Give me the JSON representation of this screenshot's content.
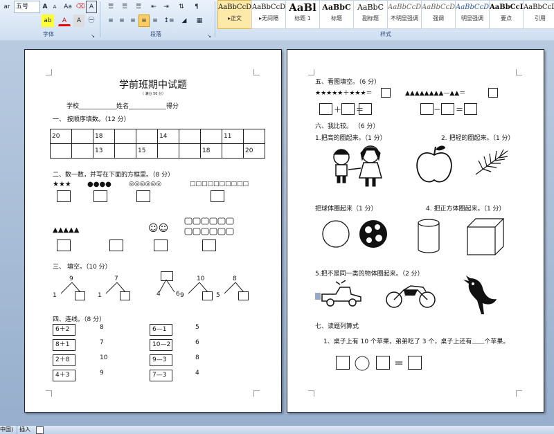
{
  "ribbon": {
    "font_name": "ar",
    "font_size": "五号",
    "font_grow": "A",
    "font_shrink": "A",
    "clear_format": "Aa",
    "phonetic": "wén",
    "char_border": "A",
    "group_font": "字体",
    "group_paragraph": "段落",
    "group_styles": "样式",
    "styles": [
      {
        "preview": "AaBbCcDc",
        "name": "▸正文"
      },
      {
        "preview": "AaBbCcDc",
        "name": "▸无间隔"
      },
      {
        "preview": "AaBl",
        "name": "标题 1"
      },
      {
        "preview": "AaBbC",
        "name": "标题"
      },
      {
        "preview": "AaBbC",
        "name": "副标题"
      },
      {
        "preview": "AaBbCcDc",
        "name": "不明显强调"
      },
      {
        "preview": "AaBbCcDc",
        "name": "强调"
      },
      {
        "preview": "AaBbCcDc",
        "name": "明显强调"
      },
      {
        "preview": "AaBbCcD",
        "name": "要点"
      },
      {
        "preview": "AaBbCcDc",
        "name": "引用"
      }
    ],
    "accent": "#eaf2fb"
  },
  "page1": {
    "title": "学前班期中试题",
    "score_note": "（ 满分 50 分）",
    "info_line": "学校____________姓名____________得分",
    "s1_title": "一、  按顺序填数。（12 分）",
    "s1_rows": [
      [
        "20",
        "",
        "18",
        "",
        "",
        "14",
        "",
        "",
        "11"
      ],
      [
        "",
        "",
        "13",
        "",
        "15",
        "",
        "",
        "18",
        "",
        "20"
      ]
    ],
    "s2_title": "二、数一数，并写在下面的方框里。（8 分）",
    "s2_stars": "★★★",
    "s2_dots": "●●●●",
    "s2_circles": "◎◎◎◎◎◎",
    "s2_squares": "□□□□□□□□□□",
    "s2_triangles": "▲▲▲▲▲",
    "s2_smiles": "☺☺",
    "s3_title": "三、  填空。（10 分）",
    "s3_items": [
      {
        "top": "9",
        "left": "1"
      },
      {
        "top": "7",
        "left": "1"
      },
      {
        "top": "",
        "left": "4",
        "right": "6"
      },
      {
        "top": "10",
        "left": "9"
      },
      {
        "top": "8",
        "left": "5"
      }
    ],
    "s4_title": "四、连线。（8 分）",
    "s4_left": [
      "6＋2",
      "8＋1",
      "2＋8",
      "4＋3"
    ],
    "s4_left_ans": [
      "8",
      "7",
      "10",
      "9"
    ],
    "s4_right": [
      "6—1",
      "10—2",
      "9—3",
      "7—3"
    ],
    "s4_right_ans": [
      "5",
      "6",
      "8",
      "4"
    ]
  },
  "page2": {
    "s5_title": "五、看图填空。（6 分）",
    "s5_stars": "★★★★★＋★★★＝",
    "s5_tris": "▲▲▲▲▲▲▲▲—▲▲＝",
    "s5_plus": "＋",
    "s5_eq": "＝",
    "s5_minus": "－",
    "s6_title": "六、我比较。   （6 分）",
    "s6_q1": "1.把高的圈起来。（1 分）",
    "s6_q2": "2. 把轻的圈起来。（1 分）",
    "s6_q3": "把球体圈起来（1 分）",
    "s6_q4": "4. 把正方体圈起来。（1 分）",
    "s6_q5": "5.把不是同一类的物体圈起来。（2 分）",
    "s7_title": "七、读题列算式",
    "s7_q": "1、桌子上有 10 个苹果，弟弟吃了 3 个，桌子上还有＿＿个苹果。",
    "s7_eq": "＝"
  },
  "status": {
    "lang": "中国)",
    "insert": "插入"
  }
}
